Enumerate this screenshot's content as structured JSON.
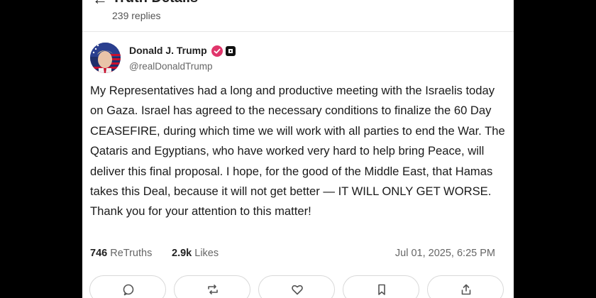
{
  "header": {
    "title": "Truth Details",
    "reply_count": "239 replies"
  },
  "post": {
    "author_name": "Donald J. Trump",
    "handle": "@realDonaldTrump",
    "body": "My Representatives had a long and productive meeting with the Israelis today on Gaza. Israel has agreed to the necessary conditions to finalize the 60 Day CEASEFIRE, during which time we will work with all parties to end the War. The Qataris and Egyptians, who have worked very hard to help bring Peace, will deliver this final proposal. I hope, for the good of the Middle East, that Hamas takes this Deal, because it will not get better — IT WILL ONLY GET WORSE. Thank you for your attention to this matter!",
    "retruths_count": "746",
    "retruths_label": "ReTruths",
    "likes_count": "2.9k",
    "likes_label": "Likes",
    "timestamp": "Jul 01, 2025, 6:25 PM"
  },
  "actions": [
    {
      "icon": "reply-icon"
    },
    {
      "icon": "retruth-icon"
    },
    {
      "icon": "heart-icon"
    },
    {
      "icon": "bookmark-icon"
    },
    {
      "icon": "share-icon"
    }
  ],
  "colors": {
    "verified": "#e0356b",
    "text": "#1a1a1a",
    "muted": "#666666"
  }
}
